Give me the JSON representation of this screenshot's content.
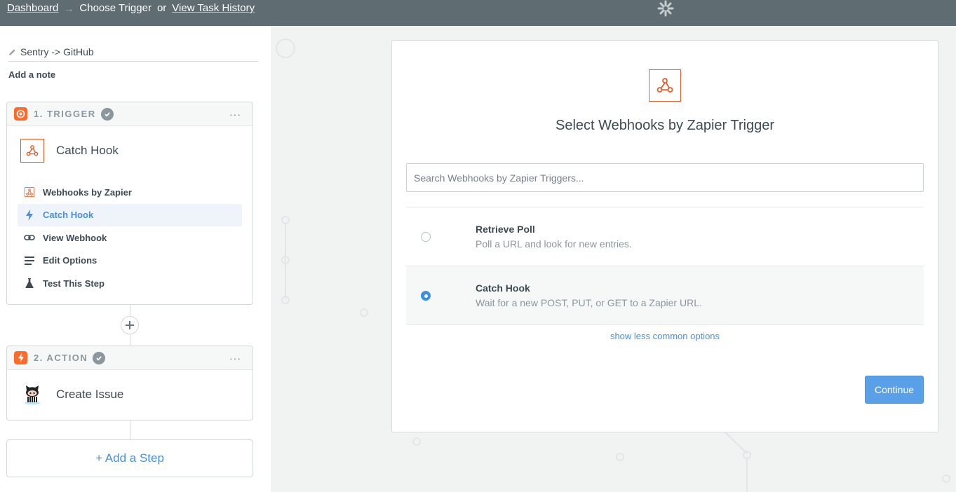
{
  "topbar": {
    "dashboard": "Dashboard",
    "arrow": "→",
    "current": "Choose Trigger",
    "or": "or",
    "history": "View Task History"
  },
  "sidebar": {
    "zap_name": "Sentry -> GitHub",
    "add_note": "Add a note",
    "trigger": {
      "label": "1. TRIGGER",
      "menu": "···",
      "title": "Catch Hook",
      "substeps": [
        {
          "label": "Webhooks by Zapier",
          "icon": "webhook-icon"
        },
        {
          "label": "Catch Hook",
          "icon": "bolt-icon"
        },
        {
          "label": "View Webhook",
          "icon": "link-icon"
        },
        {
          "label": "Edit Options",
          "icon": "list-icon"
        },
        {
          "label": "Test This Step",
          "icon": "flask-icon"
        }
      ]
    },
    "action": {
      "label": "2. ACTION",
      "menu": "···",
      "title": "Create Issue"
    },
    "add_step": "+ Add a Step"
  },
  "panel": {
    "title": "Select Webhooks by Zapier Trigger",
    "search_placeholder": "Search Webhooks by Zapier Triggers...",
    "options": [
      {
        "title": "Retrieve Poll",
        "desc": "Poll a URL and look for new entries.",
        "selected": false
      },
      {
        "title": "Catch Hook",
        "desc": "Wait for a new POST, PUT, or GET to a Zapier URL.",
        "selected": true
      }
    ],
    "more_link": "show less common options",
    "continue": "Continue"
  },
  "colors": {
    "topbar": "#5f6c72",
    "accent_blue": "#4a90d9",
    "webhook_orange": "#e35d2b",
    "trigger_badge": "#ff6a2b",
    "action_badge": "#ff6a2b"
  }
}
